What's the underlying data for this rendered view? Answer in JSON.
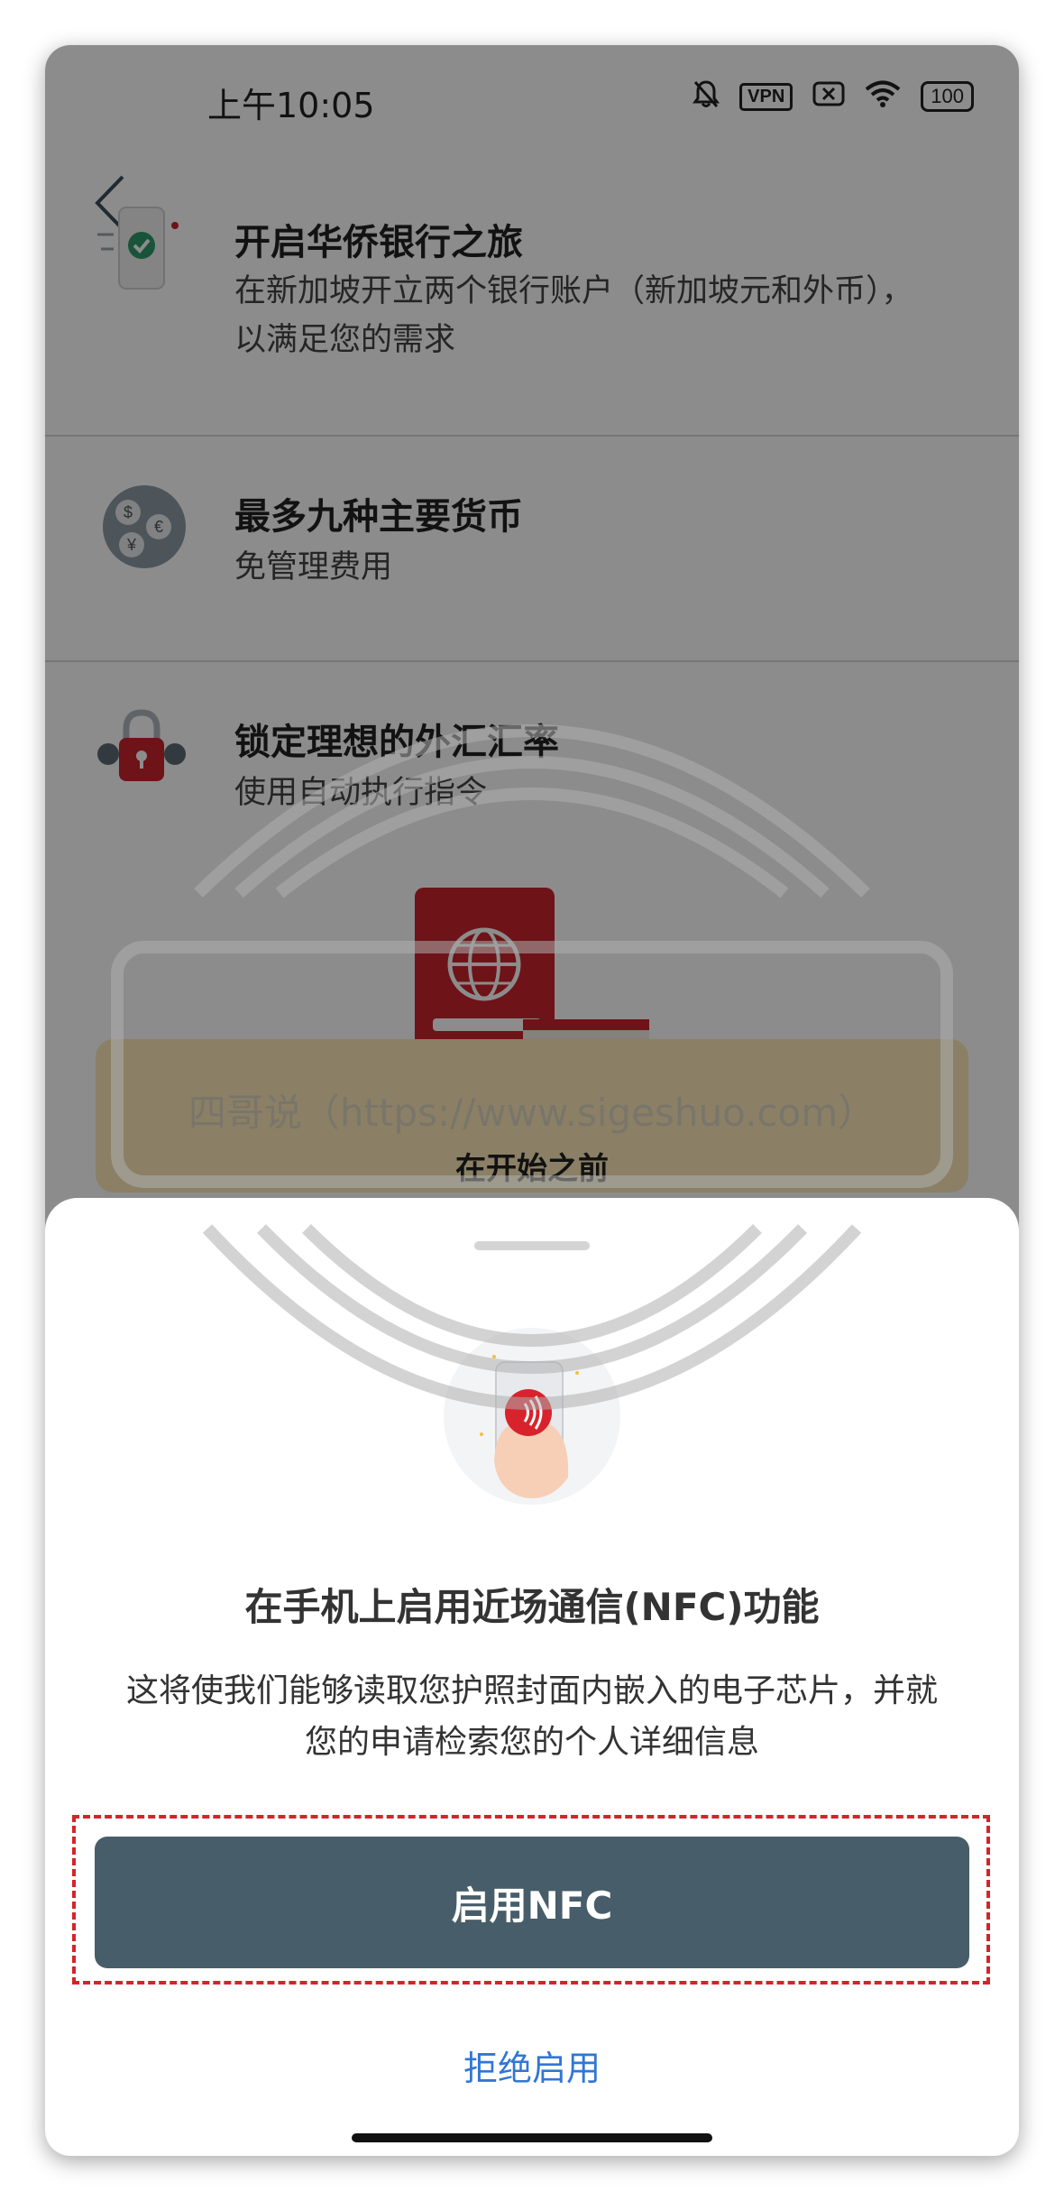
{
  "status_bar": {
    "time": "上午10:05",
    "vpn_label": "VPN",
    "battery": "100"
  },
  "features": [
    {
      "icon": "phone-check-icon",
      "title": "开启华侨银行之旅",
      "desc": "在新加坡开立两个银行账户（新加坡元和外币），以满足您的需求"
    },
    {
      "icon": "currency-coins-icon",
      "title": "最多九种主要货币",
      "desc": "免管理费用"
    },
    {
      "icon": "padlock-icon",
      "title": "锁定理想的外汇汇率",
      "desc": "使用自动执行指令"
    }
  ],
  "before_start": "在开始之前",
  "sheet": {
    "title": "在手机上启用近场通信(NFC)功能",
    "description": "这将使我们能够读取您护照封面内嵌入的电子芯片，并就您的申请检索您的个人详细信息",
    "enable_button": "启用NFC",
    "decline_link": "拒绝启用"
  },
  "watermark": "四哥说（https://www.sigeshuo.com）",
  "colors": {
    "button_bg": "#475d69",
    "link": "#3276d4",
    "brand_red": "#c8232c",
    "highlight": "#d4242b"
  }
}
